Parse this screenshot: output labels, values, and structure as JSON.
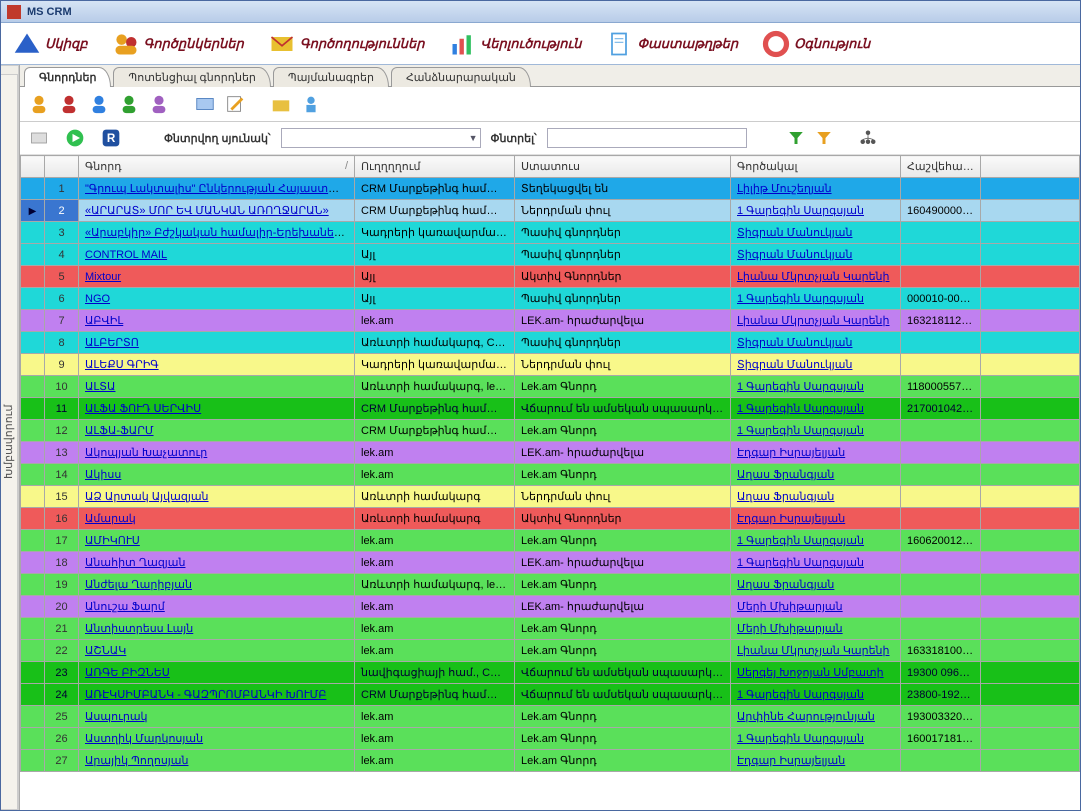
{
  "window": {
    "title": "MS CRM"
  },
  "menu": {
    "items": [
      {
        "label": "Սկիզբ"
      },
      {
        "label": "Գործընկերներ"
      },
      {
        "label": "Գործողություններ"
      },
      {
        "label": "Վերլուծություն"
      },
      {
        "label": "Փաստաթղթեր"
      },
      {
        "label": "Օգնություն"
      }
    ]
  },
  "sidebar": {
    "label": "Խմբավորում"
  },
  "tabs": {
    "items": [
      {
        "label": "Գնորդներ",
        "active": true
      },
      {
        "label": "Պոտենցիալ գնորդներ"
      },
      {
        "label": "Պայմանագրեր"
      },
      {
        "label": "Հանձնարարական"
      }
    ]
  },
  "filter": {
    "label_column": "Փնտրվող սյունակ՝",
    "label_search": "Փնտրել՝"
  },
  "columns": {
    "buyer": "Գնորդ",
    "direction": "Ուղղղղում",
    "status": "Ստատուս",
    "agent": "Գործակալ",
    "account": "Հաշվեհամար"
  },
  "rows": [
    {
      "n": "1",
      "cls": "row-blue",
      "buyer": "\"Գրուպ Լակտալիս\" Ընկերության Հայաստանյան …",
      "dir": " CRM Մարքեթինգ համակարգ",
      "stat": "Տեղեկացվել են",
      "agent": "Լիլիթ Մուշեղյան ",
      "acct": ""
    },
    {
      "n": "2",
      "cls": "row-lightblue",
      "sel": true,
      "buyer": "«ԱՐԱՐԱՏ» ՄՈՐ ԵՎ ՄԱՆԿԱՆ ԱՌՈՂՋԱՐԱՆ»",
      "dir": " CRM Մարքեթինգ համակարգ",
      "stat": "Ներդրման փուլ",
      "agent": "1 Գարեգին Սարգսյան ",
      "acct": "1604900003…"
    },
    {
      "n": "3",
      "cls": "row-cyan",
      "buyer": "«Արաբկիր» Բժշկական համալիր-Երեխաների և դե…",
      "dir": "Կադրերի կառավարման հա…",
      "stat": "Պասիվ գնորդներ",
      "agent": "Տիգրան Մանուկյան ",
      "acct": ""
    },
    {
      "n": "4",
      "cls": "row-cyan",
      "buyer": "CONTROL MAIL",
      "dir": "Այլ",
      "stat": "Պասիվ գնորդներ",
      "agent": "Տիգրան Մանուկյան ",
      "acct": ""
    },
    {
      "n": "5",
      "cls": "row-red",
      "buyer": "Mixtour",
      "dir": "Այլ",
      "stat": "Ակտիվ Գնորդներ",
      "agent": "Լիանա Մկրտչյան Կարենի",
      "acct": ""
    },
    {
      "n": "6",
      "cls": "row-cyan",
      "buyer": "NGO",
      "dir": "Այլ",
      "stat": "Պասիվ գնորդներ",
      "agent": "1 Գարեգին Սարգսյան ",
      "acct": "000010-000…"
    },
    {
      "n": "7",
      "cls": "row-violet",
      "buyer": "ԱԲՎԻԼ",
      "dir": "lek.am",
      "stat": "LEK.am- հրաժարվելա",
      "agent": "Լիանա Մկրտչյան Կարենի",
      "acct": "1632181122…"
    },
    {
      "n": "8",
      "cls": "row-cyan",
      "buyer": "ԱԼԲԵՐՏՈ",
      "dir": "Առևտրի համակարգ,  CRM …",
      "stat": "Պասիվ գնորդներ",
      "agent": "Տիգրան Մանուկյան ",
      "acct": ""
    },
    {
      "n": "9",
      "cls": "row-yellow",
      "buyer": "ԱԼԵՔՍ ԳՐԻԳ",
      "dir": "Կադրերի կառավարման հա…",
      "stat": "Ներդրման փուլ",
      "agent": "Տիգրան Մանուկյան ",
      "acct": ""
    },
    {
      "n": "10",
      "cls": "row-green",
      "buyer": "ԱԼՏԱ",
      "dir": "Առևտրի համակարգ, lek.am",
      "stat": "Lek.am Գնորդ",
      "agent": "1 Գարեգին Սարգսյան ",
      "acct": "1180005579…"
    },
    {
      "n": "11",
      "cls": "row-dgreen",
      "buyer": "ԱԼՖԱ ՖՈՒԴ ՍԵՐՎԻՍ",
      "dir": " CRM Մարքեթինգ համակարգ",
      "stat": "Վճարում են ամսեկան սպասարկում",
      "agent": "1 Գարեգին Սարգսյան ",
      "acct": "2170010421…"
    },
    {
      "n": "12",
      "cls": "row-green",
      "buyer": "ԱԼՖԱ-ՖԱՐՄ",
      "dir": " CRM Մարքեթինգ համակա…",
      "stat": "Lek.am Գնորդ",
      "agent": "1 Գարեգին Սարգսյան ",
      "acct": ""
    },
    {
      "n": "13",
      "cls": "row-violet",
      "buyer": "Ակոպյան Խաչատուր",
      "dir": "lek.am",
      "stat": "LEK.am- հրաժարվելա",
      "agent": "Էդգար Իսրայելյան ",
      "acct": ""
    },
    {
      "n": "14",
      "cls": "row-green",
      "buyer": "Ակիսս",
      "dir": "lek.am",
      "stat": "Lek.am Գնորդ",
      "agent": "Աղաս Ֆրանգյան ",
      "acct": ""
    },
    {
      "n": "15",
      "cls": "row-yellow",
      "buyer": "ԱՁ Արտակ Այվազյան",
      "dir": "Առևտրի համակարգ",
      "stat": "Ներդրման փուլ",
      "agent": "Աղաս Ֆրանգյան ",
      "acct": ""
    },
    {
      "n": "16",
      "cls": "row-red",
      "buyer": "Ամարակ",
      "dir": "Առևտրի համակարգ",
      "stat": "Ակտիվ Գնորդներ",
      "agent": "Էդգար Իսրայելյան ",
      "acct": ""
    },
    {
      "n": "17",
      "cls": "row-green",
      "buyer": "ԱՄԻԿՈՒՍ",
      "dir": "lek.am",
      "stat": "Lek.am Գնորդ",
      "agent": "1 Գարեգին Սարգսյան ",
      "acct": "1606200128…"
    },
    {
      "n": "18",
      "cls": "row-violet",
      "buyer": "Անահիտ Ղազյան",
      "dir": "lek.am",
      "stat": "LEK.am- հրաժարվելա",
      "agent": "1 Գարեգին Սարգսյան ",
      "acct": ""
    },
    {
      "n": "19",
      "cls": "row-green",
      "buyer": "Անժելա Ղարիբյան",
      "dir": "Առևտրի համակարգ, lek.am",
      "stat": "Lek.am Գնորդ",
      "agent": "Աղաս Ֆրանգյան ",
      "acct": ""
    },
    {
      "n": "20",
      "cls": "row-violet",
      "buyer": "Անուշա Ֆարմ",
      "dir": "lek.am",
      "stat": "LEK.am- հրաժարվելա",
      "agent": "Մերի Մխիթարյան ",
      "acct": ""
    },
    {
      "n": "21",
      "cls": "row-green",
      "buyer": "Անտիստրեսս Լայն",
      "dir": "lek.am",
      "stat": "Lek.am Գնորդ",
      "agent": "Մերի Մխիթարյան ",
      "acct": ""
    },
    {
      "n": "22",
      "cls": "row-green",
      "buyer": "ԱՇՆԱԿ",
      "dir": "lek.am",
      "stat": "Lek.am Գնորդ",
      "agent": "Լիանա Մկրտչյան Կարենի",
      "acct": "1633181005…"
    },
    {
      "n": "23",
      "cls": "row-dgreen",
      "buyer": "ԱՌԳԵ ԲԻԶՆԵՍ",
      "dir": "նավիգացիայի համ.,  CRM …",
      "stat": "Վճարում են ամսեկան սպասարկում",
      "agent": "Սերգեյ Խոջոյան Սմբատի",
      "acct": "19300 0965…"
    },
    {
      "n": "24",
      "cls": "row-dgreen",
      "buyer": "ԱՌԷԿՍԻՄԲԱՆԿ - ԳԱԶՊՐՈՄԲԱՆԿԻ ԽՈՒՄԲ",
      "dir": " CRM Մարքեթինգ համակա…",
      "stat": "Վճարում են ամսեկան սպասարկում",
      "agent": "1 Գարեգին Սարգսյան ",
      "acct": "23800-1923…"
    },
    {
      "n": "25",
      "cls": "row-green",
      "buyer": "Ասպուրակ",
      "dir": "lek.am",
      "stat": "Lek.am Գնորդ",
      "agent": "Արփինե Հարությունյան ",
      "acct": "1930033200…"
    },
    {
      "n": "26",
      "cls": "row-green",
      "buyer": "Աստղիկ Մարկոսյան",
      "dir": "lek.am",
      "stat": "Lek.am Գնորդ",
      "agent": "1 Գարեգին Սարգսյան ",
      "acct": "1600171815…"
    },
    {
      "n": "27",
      "cls": "row-green",
      "buyer": "Արայիկ Պողոսյան",
      "dir": "lek.am",
      "stat": "Lek.am Գնորդ",
      "agent": "Էդգար Իսրայելյան ",
      "acct": ""
    }
  ]
}
